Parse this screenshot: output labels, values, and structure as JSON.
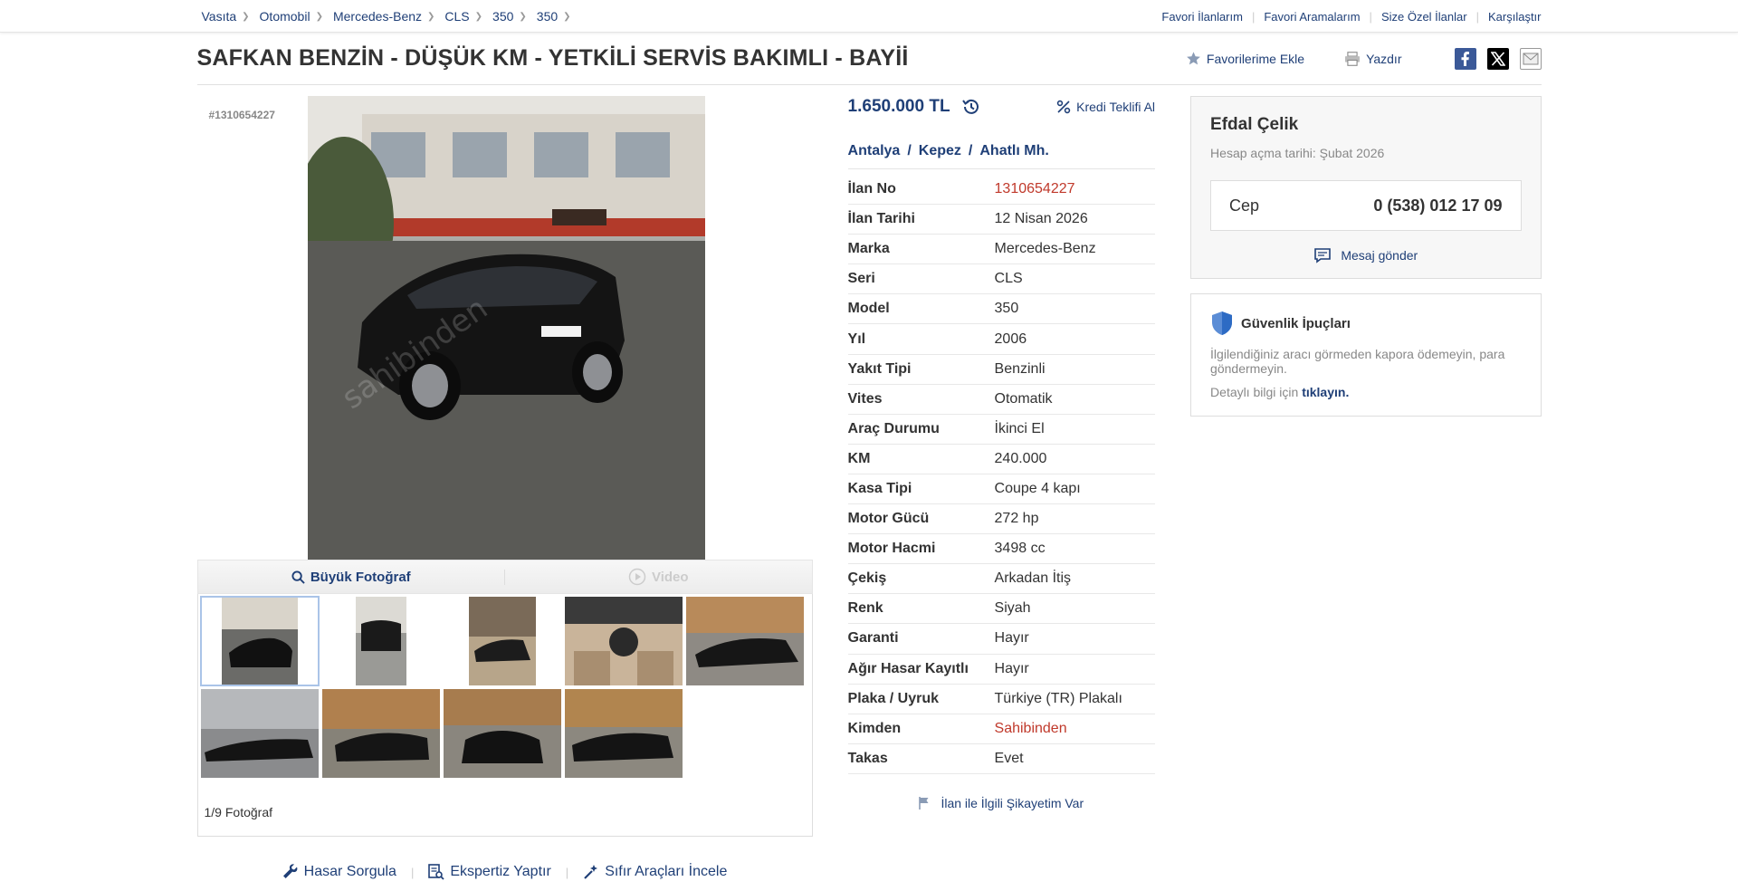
{
  "breadcrumbs": [
    "Vasıta",
    "Otomobil",
    "Mercedes-Benz",
    "CLS",
    "350",
    "350"
  ],
  "top_links": [
    "Favori İlanlarım",
    "Favori Aramalarım",
    "Size Özel İlanlar",
    "Karşılaştır"
  ],
  "title": "SAFKAN BENZİN - DÜŞÜK KM - YETKİLİ SERVİS BAKIMLI - BAYİİ",
  "actions": {
    "favorite": "Favorilerime Ekle",
    "print": "Yazdır"
  },
  "gallery": {
    "listing_ref": "#1310654227",
    "big_photo": "Büyük Fotoğraf",
    "video": "Video",
    "photo_count": "1/9 Fotoğraf",
    "watermark": "sahibinden"
  },
  "tools": [
    "Hasar Sorgula",
    "Ekspertiz Yaptır",
    "Sıfır Araçları İncele"
  ],
  "price": "1.650.000 TL",
  "loan": "Kredi Teklifi Al",
  "location": [
    "Antalya",
    "Kepez",
    "Ahatlı Mh."
  ],
  "attributes": [
    {
      "k": "İlan No",
      "v": "1310654227"
    },
    {
      "k": "İlan Tarihi",
      "v": "12 Nisan 2026"
    },
    {
      "k": "Marka",
      "v": "Mercedes-Benz"
    },
    {
      "k": "Seri",
      "v": "CLS"
    },
    {
      "k": "Model",
      "v": "350"
    },
    {
      "k": "Yıl",
      "v": "2006"
    },
    {
      "k": "Yakıt Tipi",
      "v": "Benzinli"
    },
    {
      "k": "Vites",
      "v": "Otomatik"
    },
    {
      "k": "Araç Durumu",
      "v": "İkinci El"
    },
    {
      "k": "KM",
      "v": "240.000"
    },
    {
      "k": "Kasa Tipi",
      "v": "Coupe 4 kapı"
    },
    {
      "k": "Motor Gücü",
      "v": "272 hp"
    },
    {
      "k": "Motor Hacmi",
      "v": "3498 cc"
    },
    {
      "k": "Çekiş",
      "v": "Arkadan İtiş"
    },
    {
      "k": "Renk",
      "v": "Siyah"
    },
    {
      "k": "Garanti",
      "v": "Hayır"
    },
    {
      "k": "Ağır Hasar Kayıtlı",
      "v": "Hayır"
    },
    {
      "k": "Plaka / Uyruk",
      "v": "Türkiye (TR) Plakalı"
    },
    {
      "k": "Kimden",
      "v": "Sahibinden"
    },
    {
      "k": "Takas",
      "v": "Evet"
    }
  ],
  "complaint": "İlan ile İlgili Şikayetim Var",
  "seller": {
    "name": "Efdal Çelik",
    "since": "Hesap açma tarihi: Şubat 2026",
    "phone_label": "Cep",
    "phone": "0 (538) 012 17 09",
    "message": "Mesaj gönder"
  },
  "tips": {
    "title": "Güvenlik İpuçları",
    "text": "İlgilendiğiniz aracı görmeden kapora ödemeyin, para göndermeyin.",
    "more_prefix": "Detaylı bilgi için",
    "more_link": "tıklayın."
  },
  "colors": {
    "link": "#1f3f77",
    "listing_no": "#c0392b"
  }
}
